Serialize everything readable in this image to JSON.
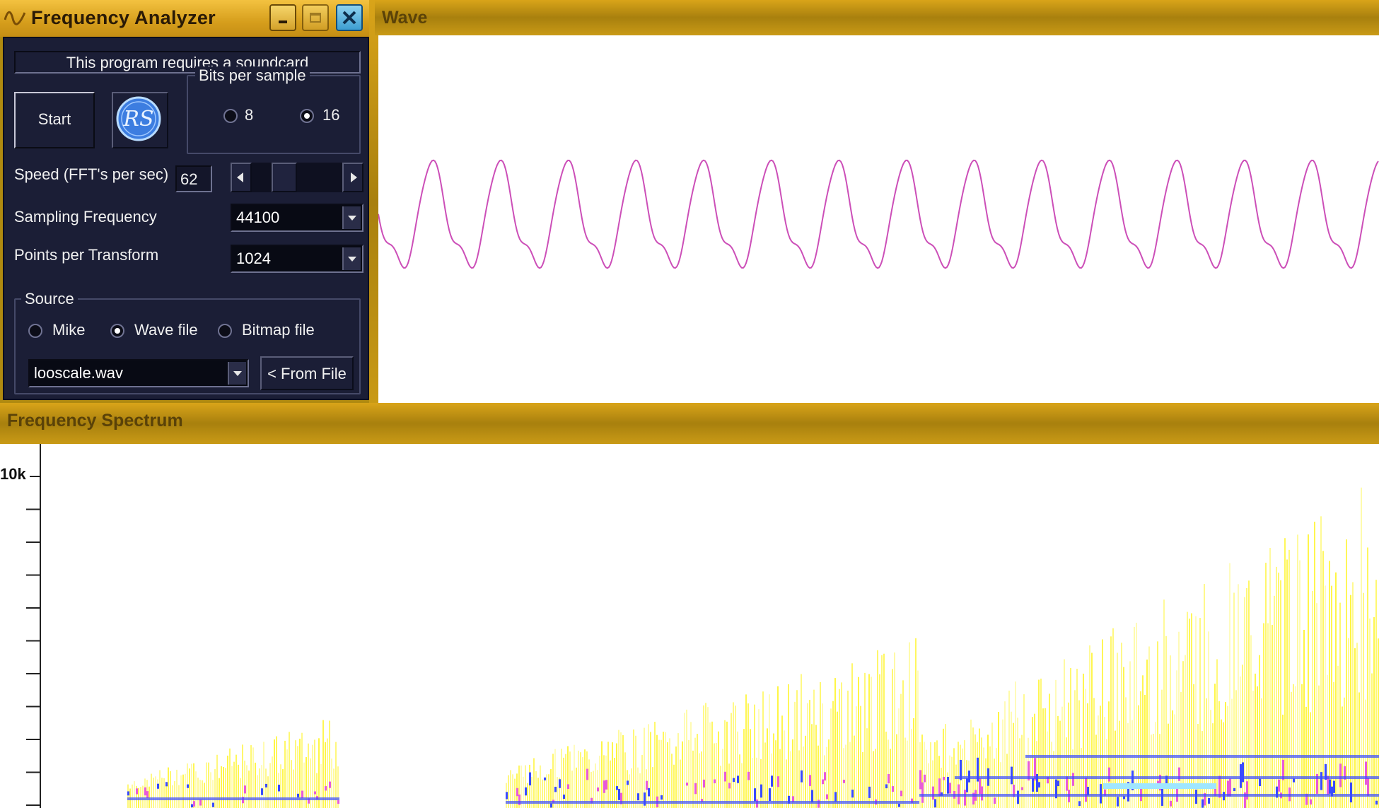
{
  "analyzer": {
    "title": "Frequency Analyzer",
    "notice": "This program requires a soundcard",
    "start_label": "Start",
    "logo_text": "RS",
    "bits_per_sample": {
      "title": "Bits per sample",
      "options": [
        "8",
        "16"
      ],
      "selected": "16"
    },
    "speed": {
      "label": "Speed (FFT's per sec)",
      "value": "62",
      "slider_fraction": 0.3
    },
    "sampling_frequency": {
      "label": "Sampling Frequency",
      "value": "44100"
    },
    "points_per_transform": {
      "label": "Points per Transform",
      "value": "1024"
    },
    "source": {
      "title": "Source",
      "options": [
        "Mike",
        "Wave file",
        "Bitmap file"
      ],
      "selected": "Wave file",
      "file_value": "looscale.wav",
      "from_file_label": "< From File"
    }
  },
  "wave": {
    "title": "Wave",
    "line_color": "#cc4fb8",
    "cycles": 14.8
  },
  "spectrum": {
    "title": "Frequency Spectrum",
    "axis_label": "10k",
    "colors": {
      "low": "#fff200",
      "mid": "#e85bd8",
      "high": "#3a4bff",
      "peak": "#9fe6ff"
    }
  }
}
